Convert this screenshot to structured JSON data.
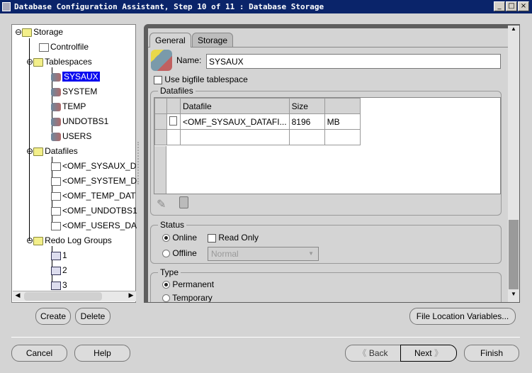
{
  "window": {
    "title": "Database Configuration Assistant, Step 10 of 11 : Database Storage",
    "controls": [
      "_",
      "□",
      "×"
    ]
  },
  "tree": {
    "root": "Storage",
    "controlfile": "Controlfile",
    "tablespaces": {
      "label": "Tablespaces",
      "items": [
        "SYSAUX",
        "SYSTEM",
        "TEMP",
        "UNDOTBS1",
        "USERS"
      ],
      "selected": "SYSAUX"
    },
    "datafiles": {
      "label": "Datafiles",
      "items": [
        "<OMF_SYSAUX_D",
        "<OMF_SYSTEM_D",
        "<OMF_TEMP_DAT",
        "<OMF_UNDOTBS1",
        "<OMF_USERS_DA"
      ]
    },
    "redo": {
      "label": "Redo Log Groups",
      "items": [
        "1",
        "2",
        "3"
      ]
    }
  },
  "tabs": {
    "general": "General",
    "storage": "Storage",
    "active": "General"
  },
  "general": {
    "name_label": "Name:",
    "name_value": "SYSAUX",
    "bigfile_label": "Use bigfile tablespace",
    "bigfile_checked": false,
    "datafiles": {
      "legend": "Datafiles",
      "columns": [
        "Datafile",
        "Size",
        ""
      ],
      "rows": [
        [
          "<OMF_SYSAUX_DATAFI...",
          "8196",
          "MB"
        ],
        [
          "",
          "",
          ""
        ]
      ]
    },
    "status": {
      "legend": "Status",
      "online": "Online",
      "offline": "Offline",
      "read_only": "Read Only",
      "selected": "Online",
      "read_only_checked": false,
      "offline_mode": "Normal"
    },
    "type": {
      "legend": "Type",
      "permanent": "Permanent",
      "temporary": "Temporary",
      "selected": "Permanent"
    }
  },
  "buttons": {
    "create": "Create",
    "delete": "Delete",
    "file_location": "File Location Variables...",
    "cancel": "Cancel",
    "help": "Help",
    "back": "Back",
    "next": "Next",
    "finish": "Finish"
  }
}
